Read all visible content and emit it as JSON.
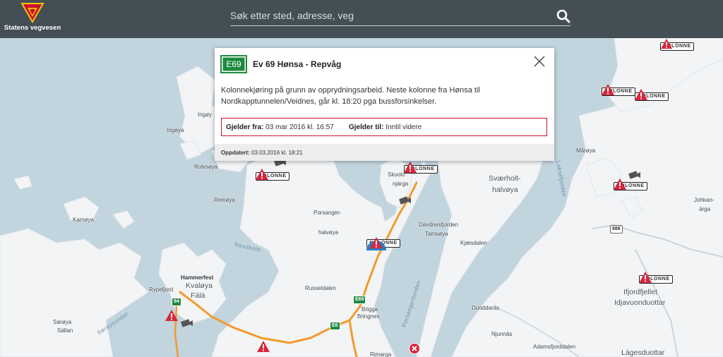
{
  "header": {
    "logo_text": "Statens vegvesen",
    "search": {
      "placeholder": "Søk etter sted, adresse, veg",
      "value": ""
    },
    "colors": {
      "bar": "#444f55",
      "logo_red": "#c8102e",
      "logo_yellow": "#f3c400"
    }
  },
  "popup": {
    "road_badge": "E69",
    "title": "Ev 69 Hønsa - Repvåg",
    "description": "Kolonnekjøring på grunn av opprydningsarbeid. Neste kolonne fra Hønsa til Nordkapptunnelen/Veidnes, går kl. 18:20 pga bussforsinkelser.",
    "valid_from_label": "Gjelder fra:",
    "valid_from_value": "03 mar 2016 kl. 16:57",
    "valid_to_label": "Gjelder til:",
    "valid_to_value": "Inntil videre",
    "updated_label": "Oppdatert:",
    "updated_value": "03.03.2016 kl. 18:21"
  },
  "markers": {
    "kolonne_label": "KOLONNE",
    "icon": "warning-triangle-icon",
    "color": "#d7263d"
  },
  "places": {
    "ingoy": "Ingøy",
    "ingoya": "Ingøya",
    "rolvsoya": "Rolvsøya",
    "reinoya": "Reinøya",
    "kamoya": "Kamøya",
    "revsbotn": "Revsbotn",
    "hammerfest": "Hammerfest",
    "kvaloya": "Kvaløya",
    "fala": "Fálá",
    "rypefjord": "Rypefjord",
    "soroysundet": "Sørøysundet",
    "soroya": "Sørøya",
    "sallan": "Sállan",
    "skuolo": "Skuolo",
    "njarga": "njárga",
    "porsanger": "Porsanger-",
    "halvoya": "halvøya",
    "russeldalen": "Russeldalen",
    "brigga": "Brigga",
    "bringnes": "Bringnes",
    "rimarga": "Rimarga",
    "davdnesfjorden": "Dávdnesfjorden",
    "tamsoya": "Tamsøya",
    "kjaesdalen": "Kjæsdalen",
    "porsangerfjorden": "Porsangerfjorden",
    "svaerholt": "Sværholt-",
    "svaerholt_halvoya": "halvøya",
    "laksefjorden": "Laksefjorden",
    "maroya": "Mårøya",
    "johkan": "Johkan-",
    "johkan_arga": "ārga",
    "duoddaras": "Duoddarās",
    "njunnas": "Njunnās",
    "adamsfjorddalen": "Adamsfjorddalen",
    "ifjordfjellet": "Ifjordfjellet",
    "idjavuonduottar": "Idjavuonduottar",
    "lagesduottar": "Lágesduottar",
    "road_e69": "E69",
    "road_e6": "E6",
    "road_94": "94",
    "road_888": "888"
  }
}
